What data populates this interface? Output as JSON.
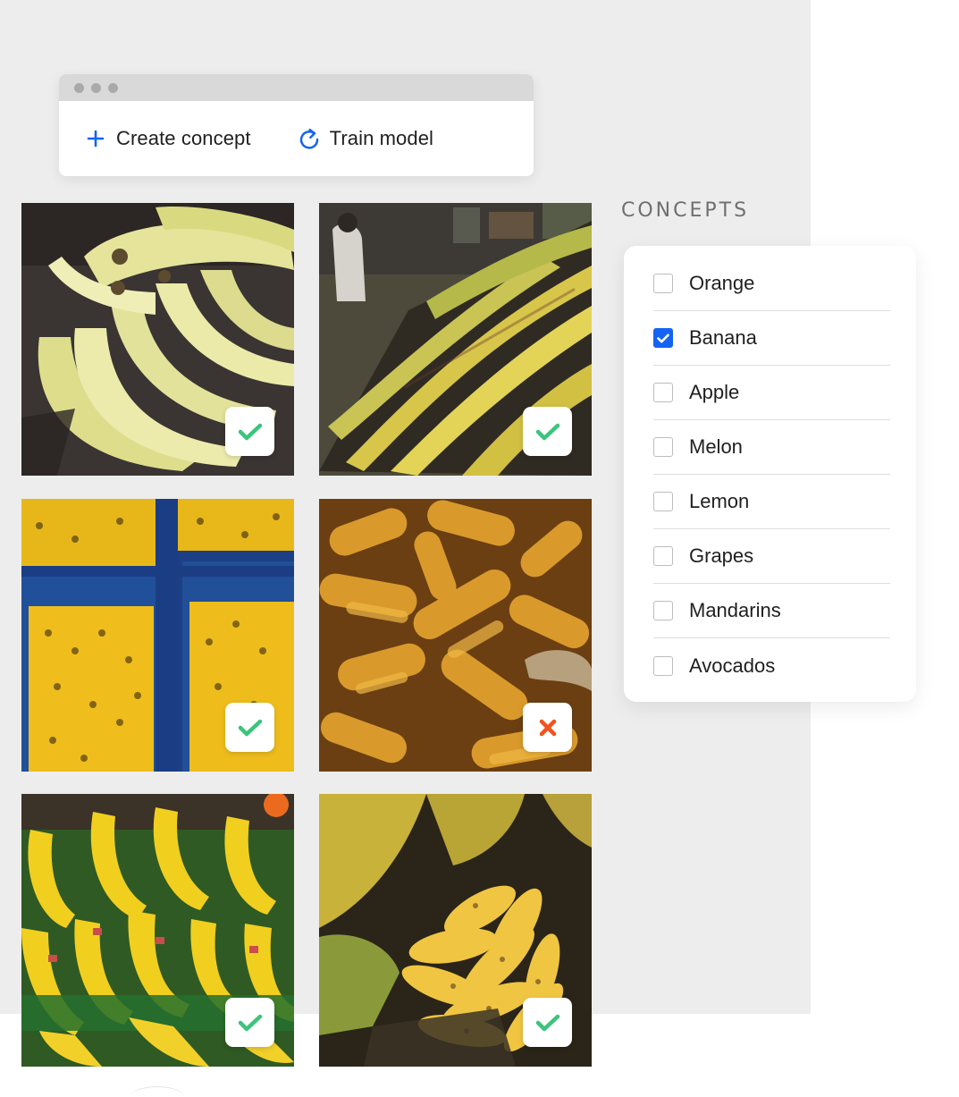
{
  "toolbar": {
    "create_label": "Create concept",
    "train_label": "Train model",
    "accent": "#1463f3"
  },
  "grid": {
    "tiles": [
      {
        "subject": "bananas",
        "status": "check"
      },
      {
        "subject": "bananas-market-shelf",
        "status": "check"
      },
      {
        "subject": "bananas-blue-crates",
        "status": "check"
      },
      {
        "subject": "corn",
        "status": "cross"
      },
      {
        "subject": "bananas-stacked",
        "status": "check"
      },
      {
        "subject": "bananas-bunch",
        "status": "check"
      }
    ],
    "check_color": "#3cc47c",
    "cross_color": "#f0531e"
  },
  "concepts": {
    "heading": "CONCEPTS",
    "items": [
      {
        "label": "Orange",
        "checked": false
      },
      {
        "label": "Banana",
        "checked": true
      },
      {
        "label": "Apple",
        "checked": false
      },
      {
        "label": "Melon",
        "checked": false
      },
      {
        "label": "Lemon",
        "checked": false
      },
      {
        "label": "Grapes",
        "checked": false
      },
      {
        "label": "Mandarins",
        "checked": false
      },
      {
        "label": "Avocados",
        "checked": false
      }
    ]
  }
}
